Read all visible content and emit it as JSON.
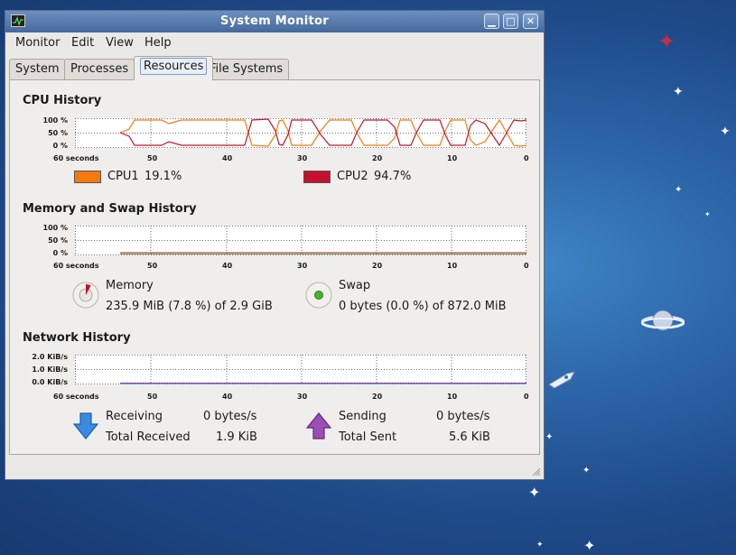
{
  "window": {
    "title": "System Monitor"
  },
  "menu": [
    {
      "label": "Monitor"
    },
    {
      "label": "Edit"
    },
    {
      "label": "View"
    },
    {
      "label": "Help"
    }
  ],
  "tabs": [
    {
      "label": "System"
    },
    {
      "label": "Processes"
    },
    {
      "label": "Resources",
      "active": true
    },
    {
      "label": "File Systems"
    }
  ],
  "x_axis_labels": [
    "60 seconds",
    "50",
    "40",
    "30",
    "20",
    "10",
    "0"
  ],
  "cpu": {
    "title": "CPU History",
    "y_labels": [
      "100 %",
      "50 %",
      "0 %"
    ],
    "cpu1": {
      "label": "CPU1",
      "value": "19.1%",
      "color": "#f47a0d"
    },
    "cpu2": {
      "label": "CPU2",
      "value": "94.7%",
      "color": "#c4122e"
    }
  },
  "memory": {
    "title": "Memory and Swap History",
    "y_labels": [
      "100 %",
      "50 %",
      "0 %"
    ],
    "mem_label": "Memory",
    "mem_value": "235.9 MiB (7.8 %) of 2.9 GiB",
    "mem_fraction": 0.078,
    "mem_color": "#c4122e",
    "swap_label": "Swap",
    "swap_value": "0 bytes (0.0 %) of 872.0 MiB",
    "swap_color": "#4caf36"
  },
  "network": {
    "title": "Network History",
    "y_labels": [
      "2.0 KiB/s",
      "1.0 KiB/s",
      "0.0 KiB/s"
    ],
    "receiving_label": "Receiving",
    "receiving_value": "0 bytes/s",
    "total_received_label": "Total Received",
    "total_received_value": "1.9 KiB",
    "sending_label": "Sending",
    "sending_value": "0 bytes/s",
    "total_sent_label": "Total Sent",
    "total_sent_value": "5.6 KiB",
    "receive_color": "#2e7fd0",
    "send_color": "#8b3fa3"
  }
}
